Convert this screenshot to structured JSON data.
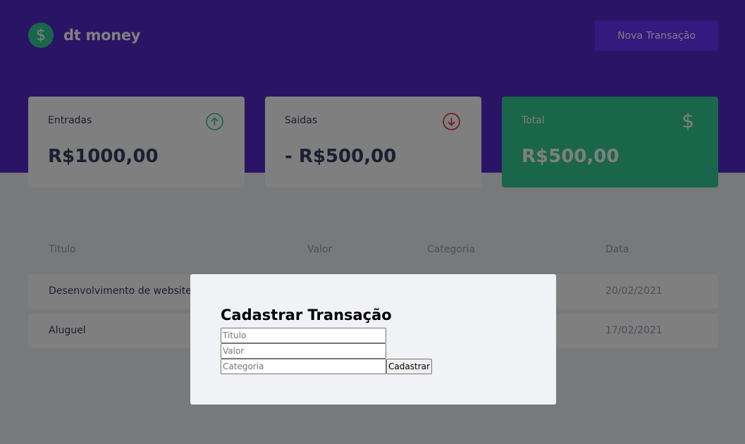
{
  "header": {
    "logo_symbol": "$",
    "logo_text": "dt money",
    "new_transaction_label": "Nova Transação"
  },
  "summary": [
    {
      "label": "Entradas",
      "value": "R$1000,00",
      "icon": "arrow-circle-up-icon"
    },
    {
      "label": "Saidas",
      "value": "- R$500,00",
      "icon": "arrow-circle-down-icon"
    },
    {
      "label": "Total",
      "value": "R$500,00",
      "icon": "dollar-icon",
      "symbol": "$"
    }
  ],
  "table": {
    "headers": [
      "Titulo",
      "Valor",
      "Categoria",
      "Data"
    ],
    "rows": [
      {
        "title": "Desenvolvimento de website",
        "value": "",
        "category": "",
        "date": "20/02/2021"
      },
      {
        "title": "Aluguel",
        "value": "",
        "category": "",
        "date": "17/02/2021"
      }
    ]
  },
  "modal": {
    "title": "Cadastrar Transação",
    "title_placeholder": "Titulo",
    "value_placeholder": "Valor",
    "category_placeholder": "Categoria",
    "submit_label": "Cadastrar"
  },
  "colors": {
    "header_bg": "#5429cc",
    "button_bg": "#6933ff",
    "green": "#33cc95",
    "red": "#e52e4d",
    "text": "#363f5f",
    "text_light": "#969cb3",
    "background": "#f0f2f5"
  }
}
